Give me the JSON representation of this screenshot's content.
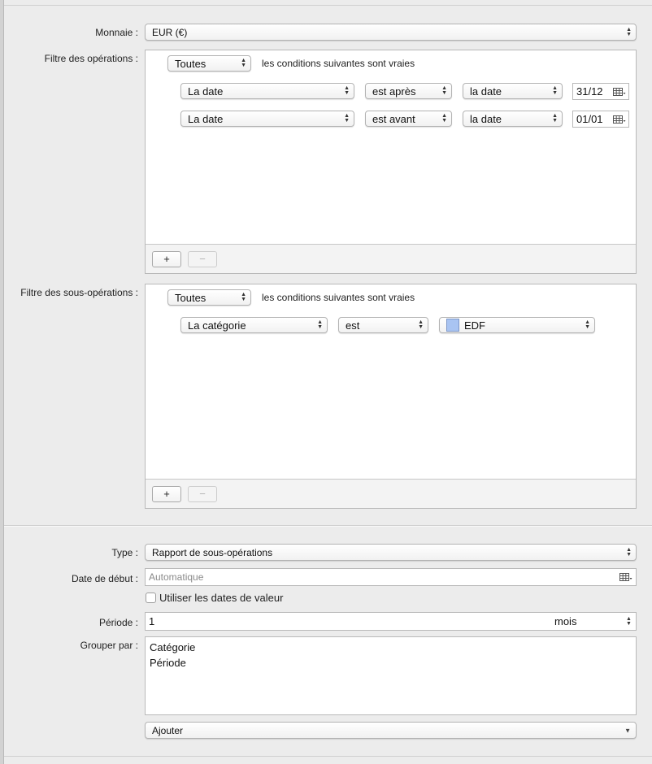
{
  "currency": {
    "label": "Monnaie :",
    "value": "EUR (€)"
  },
  "transaction_filter": {
    "label": "Filtre des opérations :",
    "match_value": "Toutes",
    "conditions_text": "les conditions suivantes sont vraies",
    "rules": [
      {
        "field": "La date",
        "operator": "est après",
        "mode": "la date",
        "date": "31/12"
      },
      {
        "field": "La date",
        "operator": "est avant",
        "mode": "la date",
        "date": "01/01"
      }
    ],
    "add_label": "+",
    "remove_label": "−"
  },
  "subtransaction_filter": {
    "label": "Filtre des sous-opérations :",
    "match_value": "Toutes",
    "conditions_text": "les conditions suivantes sont vraies",
    "rule": {
      "field": "La catégorie",
      "operator": "est",
      "value": "EDF",
      "swatch_color": "#a9c4f2"
    },
    "add_label": "+",
    "remove_label": "−"
  },
  "type": {
    "label": "Type :",
    "value": "Rapport de sous-opérations"
  },
  "start_date": {
    "label": "Date de début :",
    "placeholder": "Automatique"
  },
  "value_dates_checkbox": {
    "label": "Utiliser les dates de valeur",
    "checked": false
  },
  "period": {
    "label": "Période :",
    "value": "1",
    "unit": "mois"
  },
  "group_by": {
    "label": "Grouper par :",
    "items": [
      "Catégorie",
      "Période"
    ]
  },
  "add_popup": {
    "value": "Ajouter"
  }
}
